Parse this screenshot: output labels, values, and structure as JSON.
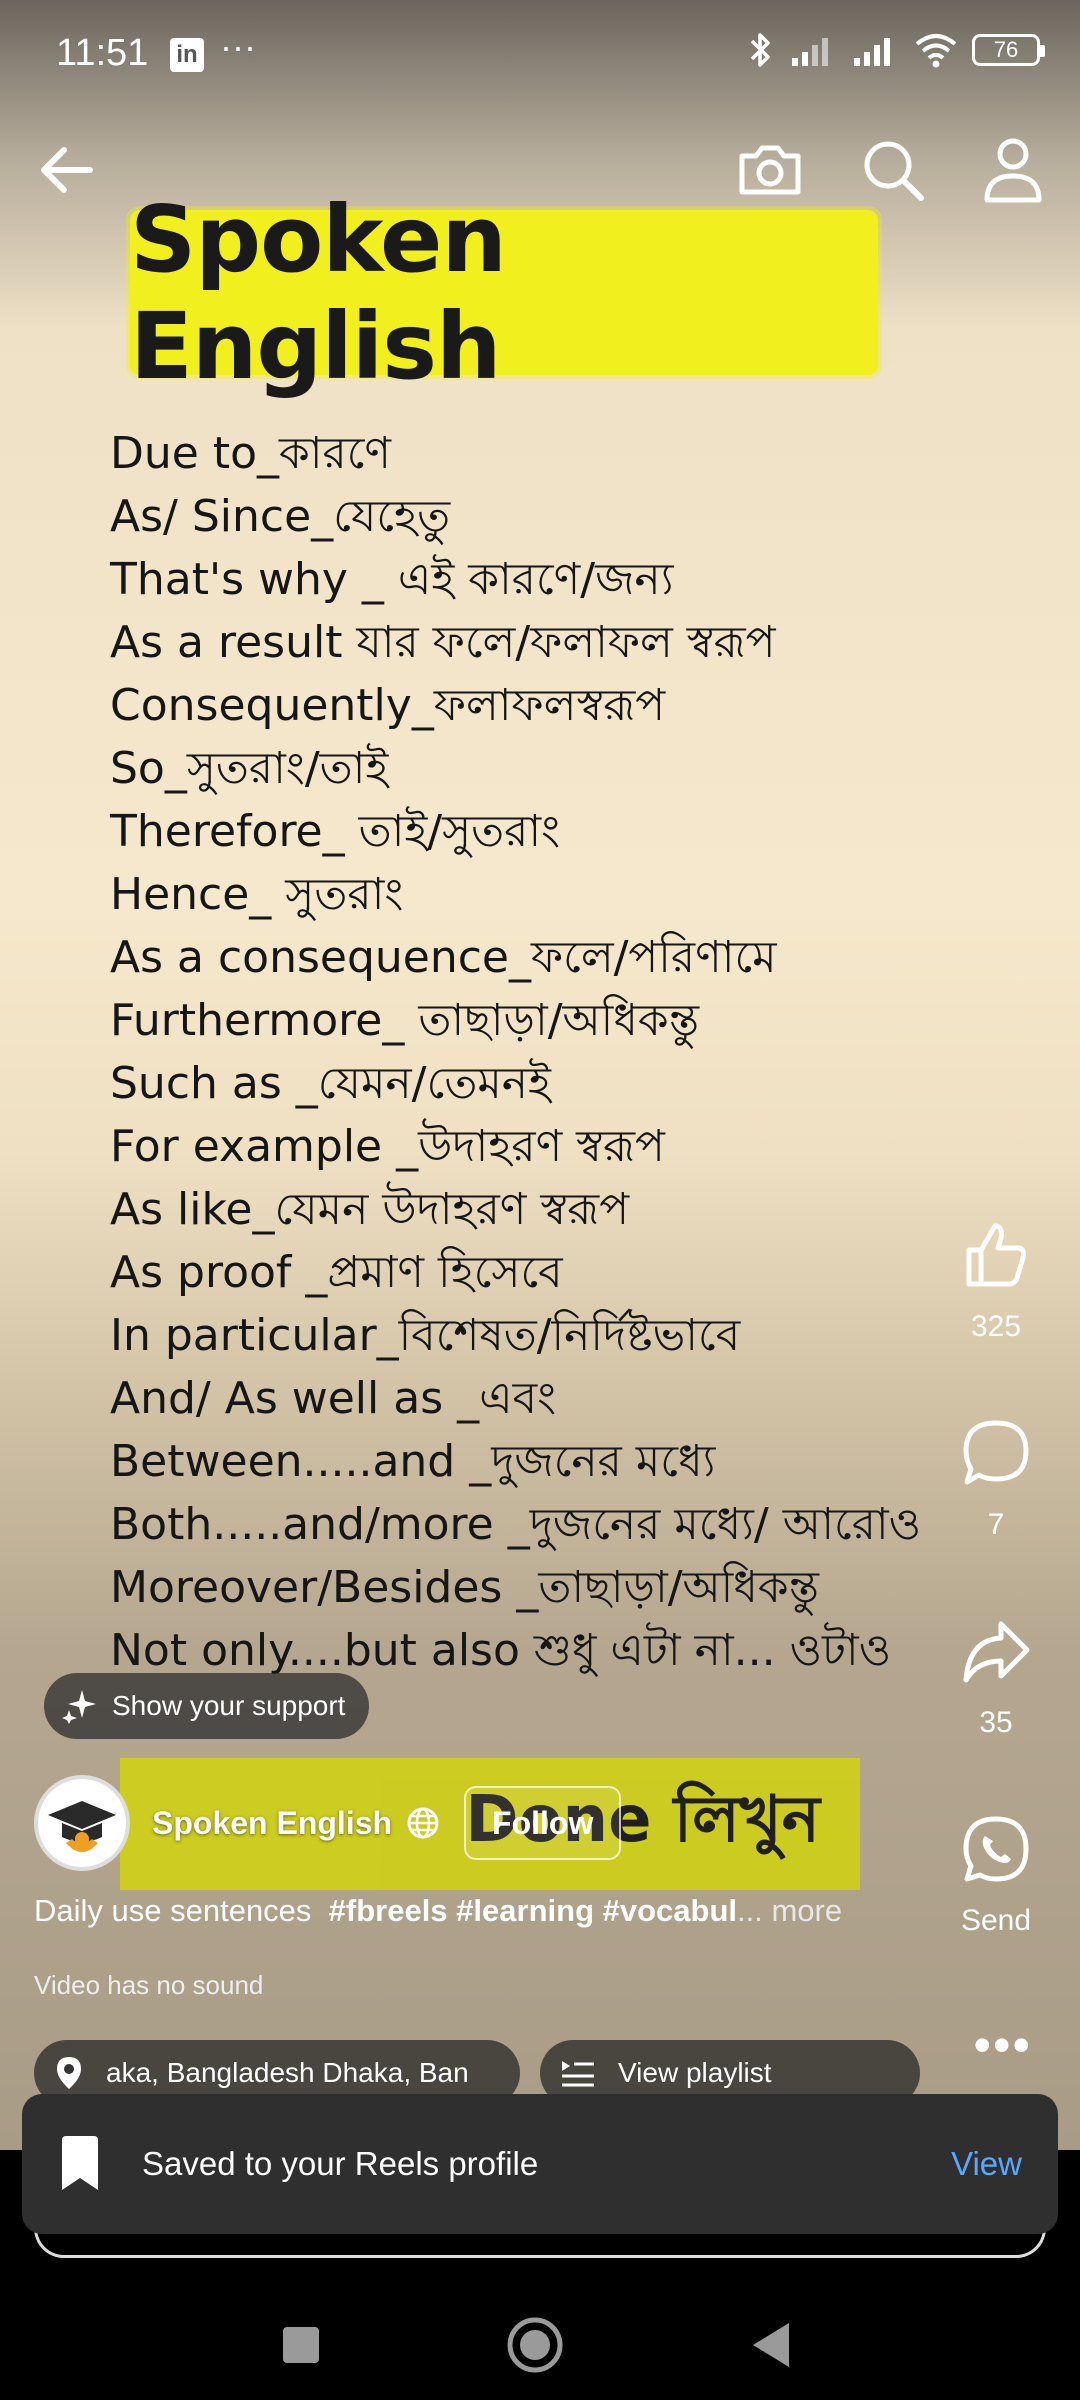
{
  "status_bar": {
    "time": "11:51",
    "app_icon": "in",
    "more": "···",
    "battery": "76"
  },
  "video": {
    "title": "Spoken English",
    "phrases": [
      "Due to_কারণে",
      "As/ Since_যেহেতু",
      "That's why _ এই কারণে/জন্য",
      "As a result যার ফলে/ফলাফল স্বরূপ",
      "Consequently_ফলাফলস্বরূপ",
      "So_সুতরাং/তাই",
      "Therefore_ তাই/সুতরাং",
      "Hence_ সুতরাং",
      "As a consequence_ফলে/পরিণামে",
      "Furthermore_ তাছাড়া/অধিকন্তু",
      "Such as _যেমন/তেমনই",
      "For example _উদাহরণ স্বরূপ",
      "As like_যেমন উদাহরণ স্বরূপ",
      "As proof _প্রমাণ হিসেবে",
      "In particular_বিশেষত/নির্দিষ্টভাবে",
      "And/ As well as _এবং",
      "Between.....and _দুজনের মধ্যে",
      "Both.....and/more _দুজনের মধ্যে/ আরোও",
      "Moreover/Besides _তাছাড়া/অধিকন্তু",
      "Not only....but also শুধু এটা না... ওটাও"
    ],
    "caption": "Done লিখুন"
  },
  "rail": {
    "likes": "325",
    "comments": "7",
    "shares": "35",
    "send_label": "Send"
  },
  "support_label": "Show your support",
  "author": {
    "name": "Spoken English",
    "follow_label": "Follow"
  },
  "description": {
    "text": "Daily use sentences",
    "tags": "#fbreels #learning #vocabul",
    "more": "... more"
  },
  "no_sound": "Video has no sound",
  "location": "aka, Bangladesh     Dhaka, Ban",
  "playlist_label": "View playlist",
  "toast": {
    "text": "Saved to your Reels profile",
    "action": "View"
  },
  "colors": {
    "title_bg": "#f2ef1f",
    "link_blue": "#5aa7ff",
    "toast_bg": "#2f2f2f"
  }
}
